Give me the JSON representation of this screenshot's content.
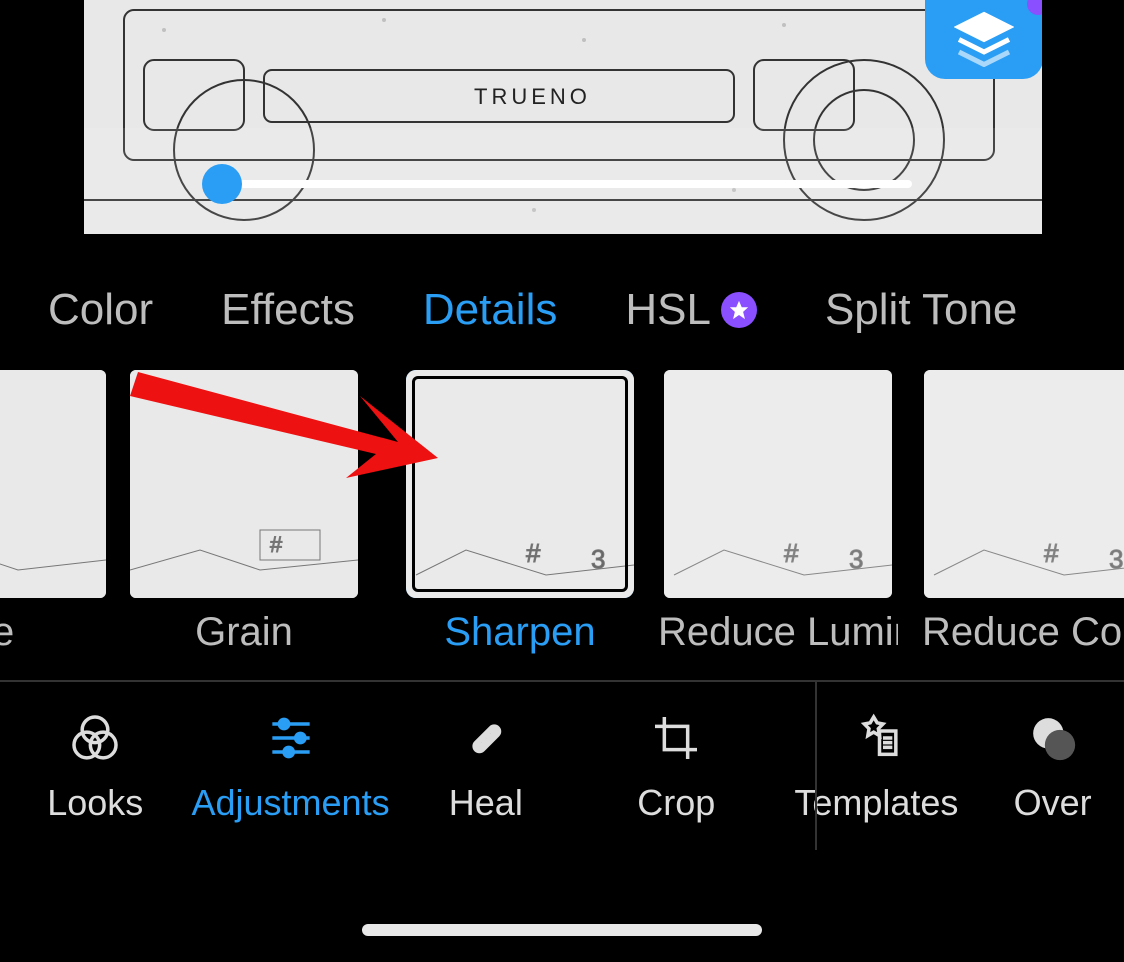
{
  "preview": {
    "car_text": "TRUENO"
  },
  "slider": {
    "value": 0
  },
  "tabs": {
    "items": [
      {
        "label": "Color"
      },
      {
        "label": "Effects"
      },
      {
        "label": "Details",
        "active": true
      },
      {
        "label": "HSL",
        "premium": true
      },
      {
        "label": "Split Tone",
        "cutoff": true
      }
    ]
  },
  "thumbs": {
    "items": [
      {
        "label": "de",
        "cutoff_left": true
      },
      {
        "label": "Grain"
      },
      {
        "label": "Sharpen",
        "selected": true
      },
      {
        "label": "Reduce Lumina",
        "premium": true
      },
      {
        "label": "Reduce Colo",
        "cutoff_right": true
      }
    ]
  },
  "toolbar": {
    "items": [
      {
        "label": "Looks",
        "icon": "venn"
      },
      {
        "label": "Adjustments",
        "icon": "sliders",
        "active": true
      },
      {
        "label": "Heal",
        "icon": "bandage"
      },
      {
        "label": "Crop",
        "icon": "crop"
      },
      {
        "label": "Templates",
        "icon": "templates"
      },
      {
        "label": "Over",
        "icon": "overlay",
        "cutoff": true
      }
    ]
  }
}
